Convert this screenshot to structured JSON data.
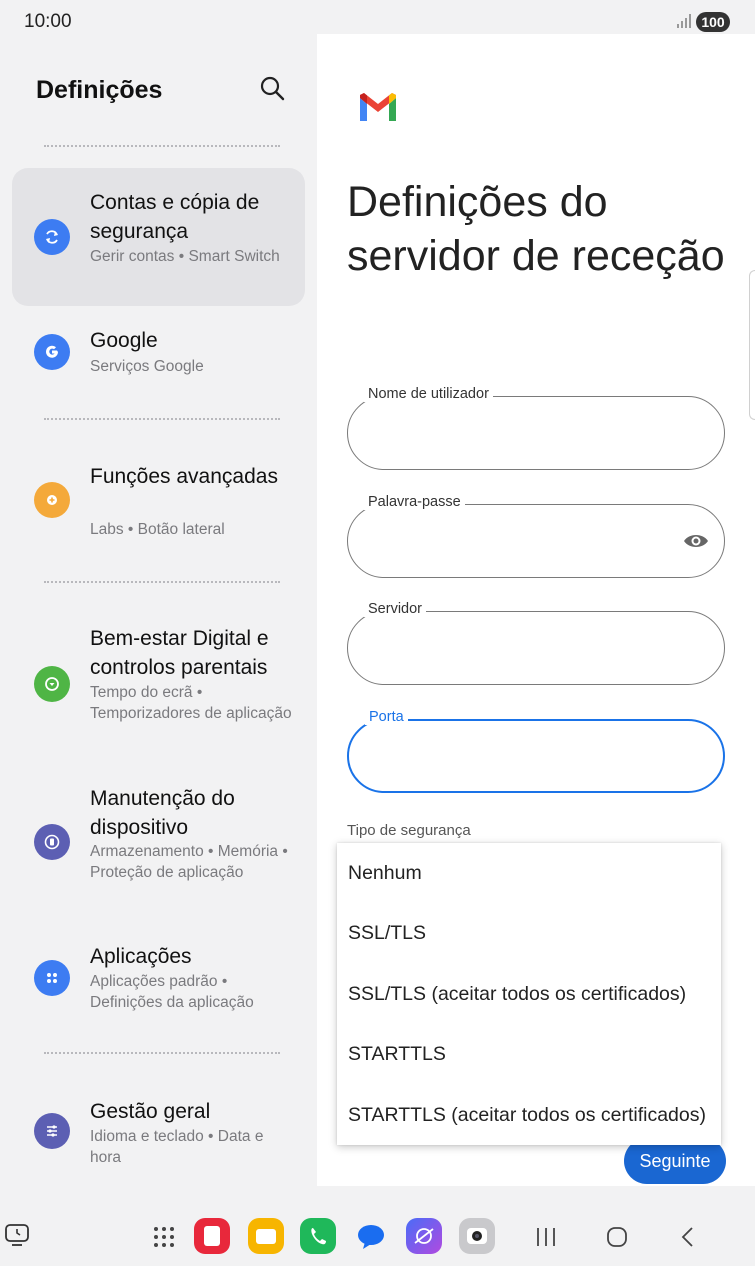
{
  "status_bar": {
    "time": "10:00",
    "battery": "100"
  },
  "left_panel": {
    "title": "Definições",
    "items": [
      {
        "title": "Contas e cópia de segurança",
        "subtitle": "Gerir contas • Smart Switch",
        "icon": "sync-icon",
        "color": "#3d7cf2",
        "selected": true
      },
      {
        "title": "Google",
        "subtitle": "Serviços Google",
        "icon": "google-icon",
        "color": "#3d7cf2"
      },
      {
        "title": "Funções avançadas",
        "subtitle": "Labs • Botão lateral",
        "icon": "gear-plus-icon",
        "color": "#f4a93a"
      },
      {
        "title": "Bem-estar Digital e controlos parentais",
        "subtitle": "Tempo do ecrã • Temporizadores de aplicação",
        "icon": "wellbeing-icon",
        "color": "#4fb545"
      },
      {
        "title": "Manutenção do dispositivo",
        "subtitle": "Armazenamento • Memória • Proteção de aplicação",
        "icon": "device-care-icon",
        "color": "#5c5fb3"
      },
      {
        "title": "Aplicações",
        "subtitle": "Aplicações padrão • Definições da aplicação",
        "icon": "apps-grid-icon",
        "color": "#3d7cf2"
      },
      {
        "title": "Gestão geral",
        "subtitle": "Idioma e teclado • Data e hora",
        "icon": "sliders-icon",
        "color": "#5c5fb3"
      }
    ]
  },
  "right_panel": {
    "title": "Definições do servidor de receção",
    "fields": {
      "username": {
        "label": "Nome de utilizador",
        "value": ""
      },
      "password": {
        "label": "Palavra-passe",
        "value": ""
      },
      "server": {
        "label": "Servidor",
        "value": ""
      },
      "port": {
        "label": "Porta",
        "value": ""
      }
    },
    "security_label": "Tipo de segurança",
    "security_options": [
      "Nenhum",
      "SSL/TLS",
      "SSL/TLS (aceitar todos os certificados)",
      "STARTTLS",
      "STARTTLS (aceitar todos os certificados)"
    ],
    "next_label": "Seguinte"
  },
  "colors": {
    "accent": "#1a73e8",
    "button": "#1a67d2"
  }
}
